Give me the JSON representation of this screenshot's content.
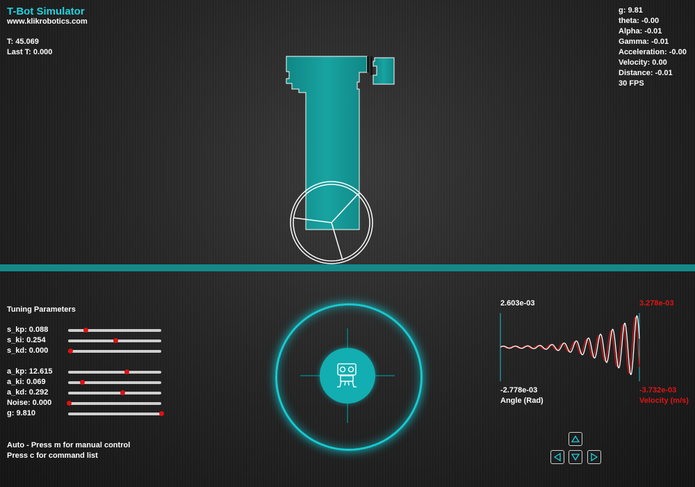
{
  "app": {
    "title": "T-Bot Simulator",
    "website": "www.klikrobotics.com"
  },
  "time": {
    "t": "T: 45.069",
    "last_t": "Last T: 0.000"
  },
  "stats": [
    "g: 9.81",
    "theta: -0.00",
    "Alpha: -0.01",
    "Gamma: -0.01",
    "Acceleration: -0.00",
    "Velocity: 0.00",
    "Distance: -0.01",
    "30 FPS"
  ],
  "tuning": {
    "title": "Tuning Parameters",
    "params": [
      {
        "key": "s_kp",
        "label": "s_kp: 0.088",
        "level": 0.19
      },
      {
        "key": "s_ki",
        "label": "s_ki: 0.254",
        "level": 0.51
      },
      {
        "key": "s_kd",
        "label": "s_kd: 0.000",
        "level": 0.02
      },
      {
        "key": "a_kp",
        "label": "a_kp: 12.615",
        "level": 0.63
      },
      {
        "key": "a_ki",
        "label": "a_ki: 0.069",
        "level": 0.15
      },
      {
        "key": "a_kd",
        "label": "a_kd: 0.292",
        "level": 0.58
      },
      {
        "key": "noise",
        "label": "Noise: 0.000",
        "level": 0.01
      },
      {
        "key": "g",
        "label": "g: 9.810",
        "level": 1.0
      }
    ]
  },
  "mode": {
    "line1": "Auto - Press m for manual control",
    "line2": "Press c for command list"
  },
  "plot": {
    "angle_max": "2.603e-03",
    "angle_min": "-2.778e-03",
    "angle_label": "Angle (Rad)",
    "velocity_max": "3.278e-03",
    "velocity_min": "-3.732e-03",
    "velocity_label": "Velocity (m/s)",
    "angle_color": "#ffffff",
    "velocity_color": "#e01414"
  },
  "colors": {
    "accent": "#1fd3e0",
    "robot_body": "#12908f",
    "ground": "#138a89",
    "slider_knob": "#e01010"
  },
  "icons": {
    "joystick_center": "robot-icon",
    "arrow_up": "arrow-up-icon",
    "arrow_down": "arrow-down-icon",
    "arrow_left": "arrow-left-icon",
    "arrow_right": "arrow-right-icon"
  }
}
